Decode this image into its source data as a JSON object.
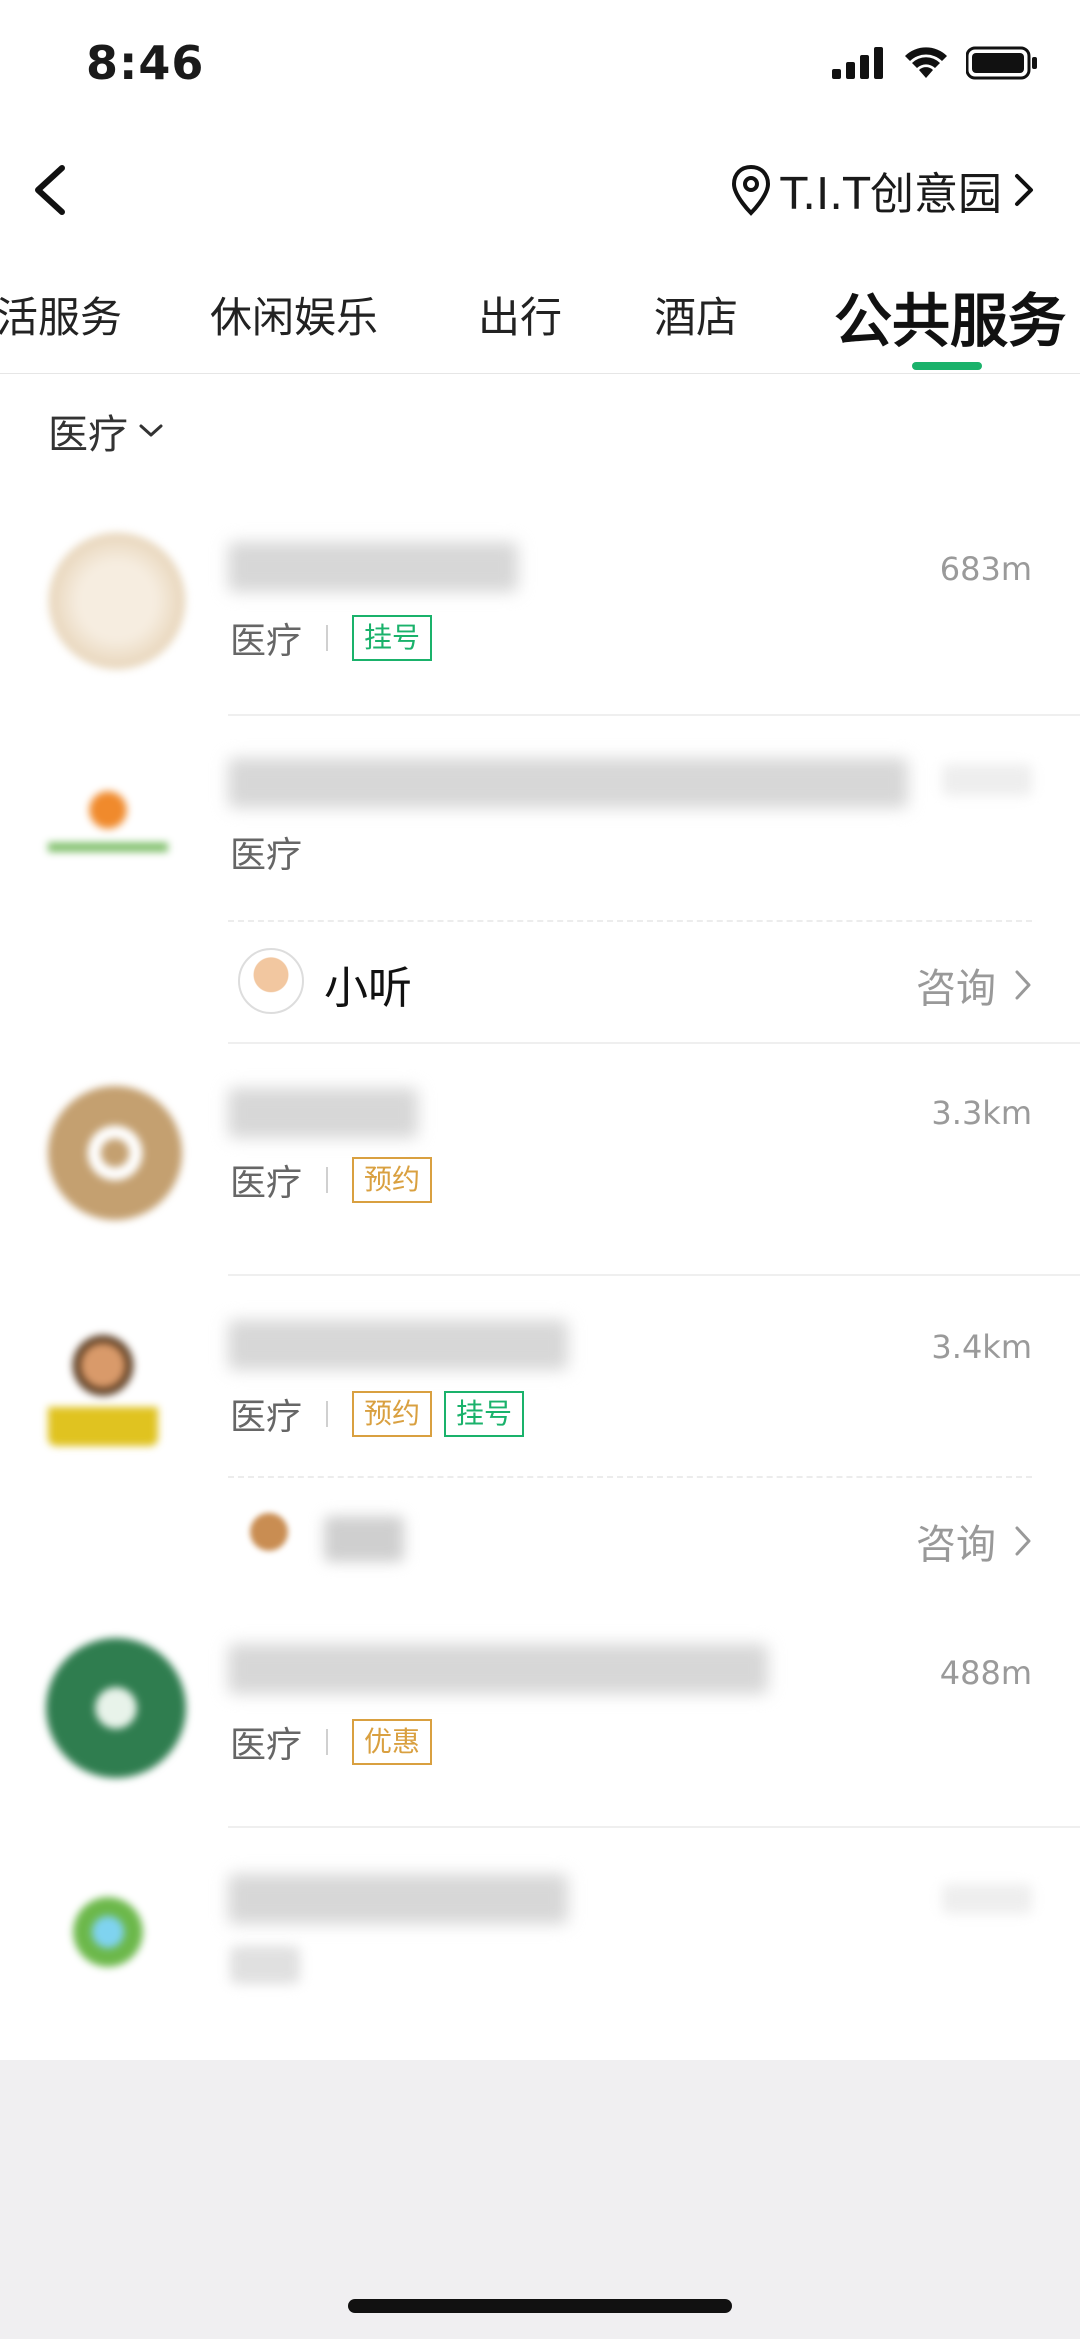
{
  "status_bar": {
    "time": "8:46"
  },
  "nav": {
    "location": "T.I.T创意园"
  },
  "tabs": [
    {
      "label": "活服务"
    },
    {
      "label": "休闲娱乐"
    },
    {
      "label": "出行"
    },
    {
      "label": "酒店"
    },
    {
      "label": "公共服务",
      "active": true
    }
  ],
  "filter": {
    "label": "医疗"
  },
  "items": [
    {
      "distance": "683m",
      "category": "医疗",
      "tags": [
        {
          "label": "挂号",
          "color": "#1ab26b"
        }
      ]
    },
    {
      "distance": "",
      "category": "医疗",
      "tags": [],
      "sub": {
        "name": "小听",
        "action": "咨询"
      }
    },
    {
      "distance": "3.3km",
      "category": "医疗",
      "tags": [
        {
          "label": "预约",
          "color": "#d9a040"
        }
      ]
    },
    {
      "distance": "3.4km",
      "category": "医疗",
      "tags": [
        {
          "label": "预约",
          "color": "#d9a040"
        },
        {
          "label": "挂号",
          "color": "#1ab26b"
        }
      ],
      "sub": {
        "name": "",
        "action": "咨询"
      }
    },
    {
      "distance": "488m",
      "category": "医疗",
      "tags": [
        {
          "label": "优惠",
          "color": "#d9a040"
        }
      ]
    },
    {
      "distance": "",
      "category": "",
      "tags": []
    }
  ],
  "colors": {
    "accent": "#1ab26b",
    "tag_orange": "#d9a040",
    "bottom_bg": "#f0eff1"
  }
}
